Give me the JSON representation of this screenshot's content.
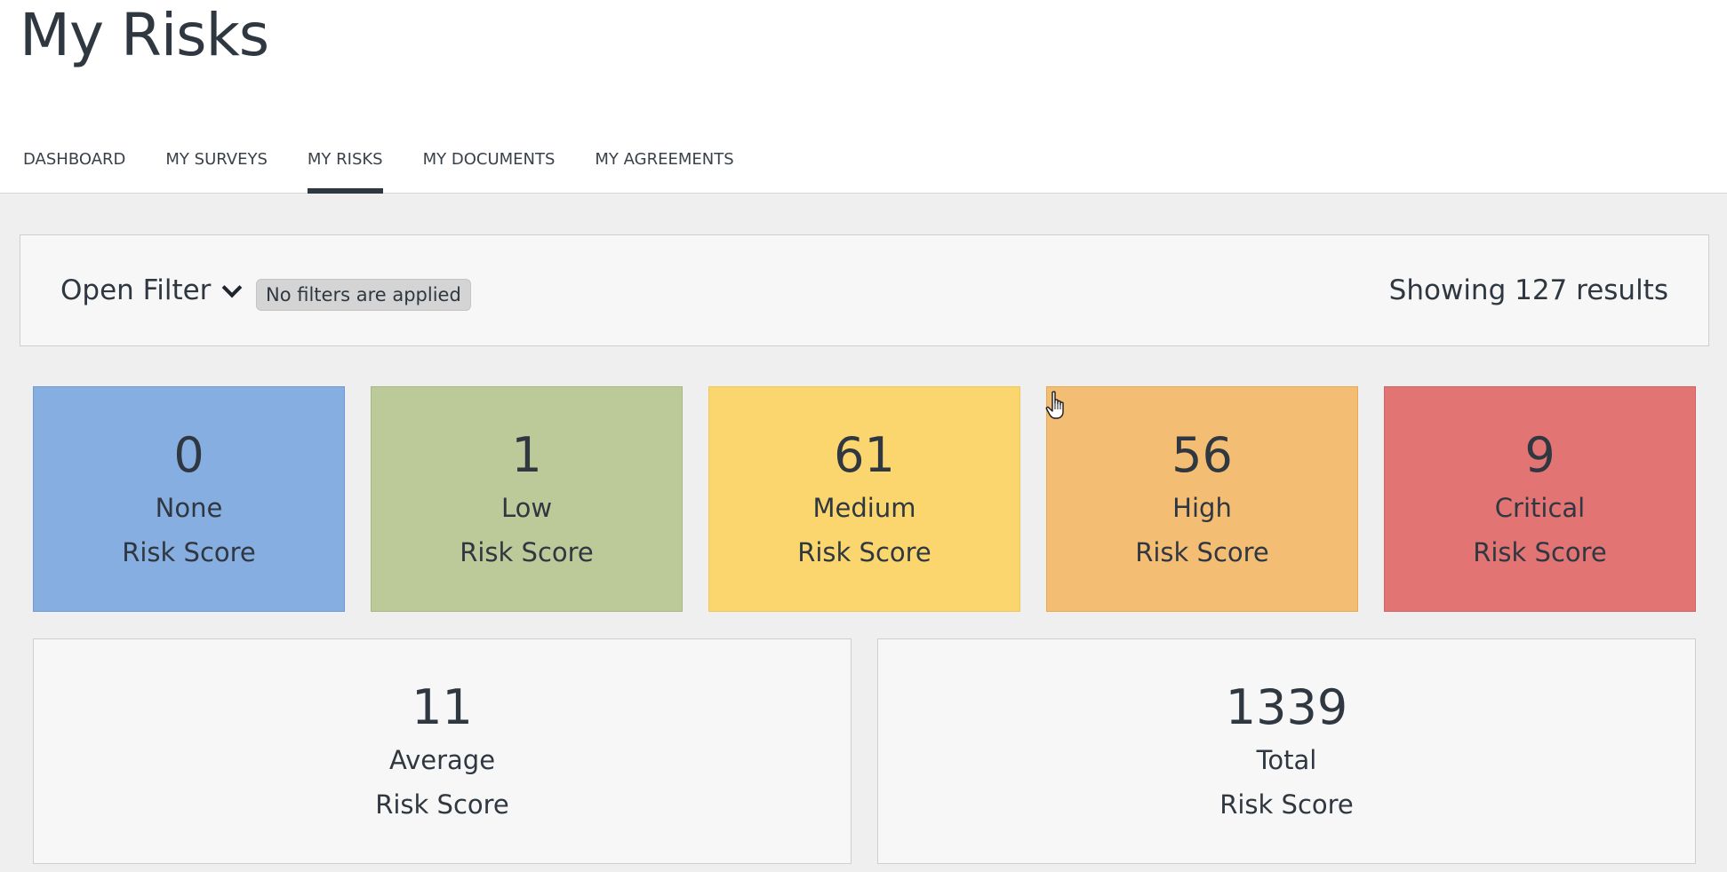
{
  "page": {
    "title": "My Risks"
  },
  "tabs": [
    {
      "label": "DASHBOARD",
      "active": false
    },
    {
      "label": "MY SURVEYS",
      "active": false
    },
    {
      "label": "MY RISKS",
      "active": true
    },
    {
      "label": "MY DOCUMENTS",
      "active": false
    },
    {
      "label": "MY AGREEMENTS",
      "active": false
    }
  ],
  "filter": {
    "toggle_label": "Open Filter",
    "badge": "No filters are applied",
    "results": "Showing 127 results"
  },
  "score_cards": [
    {
      "value": "0",
      "label": "None",
      "sub": "Risk Score",
      "color": "#86aee0",
      "border": "#6f9bd4"
    },
    {
      "value": "1",
      "label": "Low",
      "sub": "Risk Score",
      "color": "#bcc998",
      "border": "#a9b784"
    },
    {
      "value": "61",
      "label": "Medium",
      "sub": "Risk Score",
      "color": "#fbd56e",
      "border": "#f2c65a"
    },
    {
      "value": "56",
      "label": "High",
      "sub": "Risk Score",
      "color": "#f4bd74",
      "border": "#eaa850"
    },
    {
      "value": "9",
      "label": "Critical",
      "sub": "Risk Score",
      "color": "#e37474",
      "border": "#d66262"
    }
  ],
  "summary_cards": [
    {
      "value": "11",
      "label": "Average",
      "sub": "Risk Score"
    },
    {
      "value": "1339",
      "label": "Total",
      "sub": "Risk Score"
    }
  ]
}
